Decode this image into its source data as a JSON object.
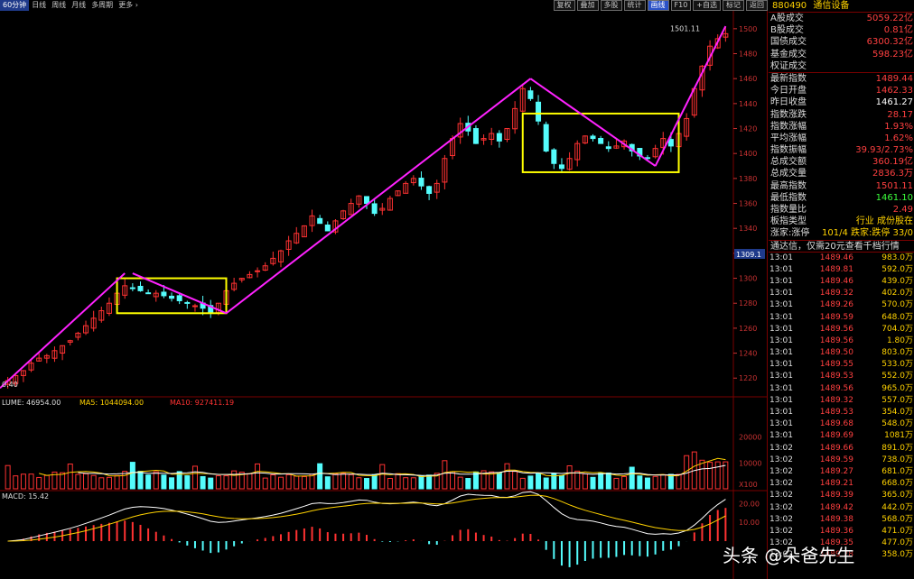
{
  "tabs": [
    {
      "label": "60分钟",
      "active": true
    },
    {
      "label": "日线",
      "active": false
    },
    {
      "label": "周线",
      "active": false
    },
    {
      "label": "月线",
      "active": false
    },
    {
      "label": "多周期",
      "active": false
    },
    {
      "label": "更多 ›",
      "active": false
    }
  ],
  "tools": [
    {
      "label": "复权",
      "active": false
    },
    {
      "label": "叠加",
      "active": false
    },
    {
      "label": "多股",
      "active": false
    },
    {
      "label": "统计",
      "active": false
    },
    {
      "label": "画线",
      "active": true
    },
    {
      "label": "F10",
      "active": false
    },
    {
      "label": "+自选",
      "active": false
    },
    {
      "label": "标记",
      "active": false
    },
    {
      "label": "返回",
      "active": false
    }
  ],
  "chart": {
    "max_label": "1501.11",
    "low_label": "0.40",
    "price_tag": "1309.1",
    "volume_info": {
      "vol": "LUME: 46954.00",
      "ma5": "MA5: 1044094.00",
      "ma10": "MA10: 927411.19"
    },
    "macd_info": "MACD: 15.42",
    "vol_badge": "X100"
  },
  "chart_data": {
    "type": "candlestick",
    "y_ticks": [
      1220,
      1240,
      1260,
      1280,
      1300,
      1320,
      1340,
      1360,
      1380,
      1400,
      1420,
      1440,
      1460,
      1480,
      1500
    ],
    "ylim": [
      1205,
      1510
    ],
    "volume_ticks": [
      10000,
      20000
    ],
    "macd_ticks": [
      10.0,
      20.0
    ],
    "close_series": [
      1218,
      1222,
      1226,
      1232,
      1236,
      1238,
      1242,
      1246,
      1250,
      1256,
      1262,
      1268,
      1274,
      1280,
      1288,
      1294,
      1292,
      1290,
      1288,
      1288,
      1286,
      1284,
      1282,
      1280,
      1278,
      1276,
      1272,
      1280,
      1290,
      1296,
      1300,
      1303,
      1306,
      1310,
      1316,
      1322,
      1330,
      1336,
      1342,
      1350,
      1344,
      1338,
      1346,
      1354,
      1360,
      1366,
      1360,
      1352,
      1356,
      1364,
      1370,
      1376,
      1380,
      1374,
      1368,
      1376,
      1396,
      1412,
      1424,
      1418,
      1408,
      1412,
      1416,
      1410,
      1420,
      1436,
      1452,
      1444,
      1426,
      1402,
      1392,
      1388,
      1396,
      1408,
      1414,
      1412,
      1408,
      1404,
      1406,
      1410,
      1402,
      1398,
      1396,
      1404,
      1412,
      1406,
      1416,
      1428,
      1452,
      1470,
      1486,
      1492,
      1496
    ]
  },
  "side": {
    "code": "880490",
    "name": "通信设备",
    "stats": [
      {
        "label": "A股成交",
        "value": "5059.22亿"
      },
      {
        "label": "B股成交",
        "value": "0.81亿"
      },
      {
        "label": "国债成交",
        "value": "6300.32亿"
      },
      {
        "label": "基金成交",
        "value": "598.23亿"
      },
      {
        "label": "权证成交",
        "value": ""
      }
    ],
    "index": [
      {
        "label": "最新指数",
        "value": "1489.44"
      },
      {
        "label": "今日开盘",
        "value": "1462.33"
      },
      {
        "label": "昨日收盘",
        "value": "1461.27"
      },
      {
        "label": "指数涨跌",
        "value": "28.17"
      },
      {
        "label": "指数涨幅",
        "value": "1.93%"
      },
      {
        "label": "平均涨幅",
        "value": "1.62%"
      },
      {
        "label": "指数振幅",
        "value": "39.93/2.73%"
      },
      {
        "label": "总成交额",
        "value": "360.19亿"
      },
      {
        "label": "总成交量",
        "value": "2836.3万"
      },
      {
        "label": "最高指数",
        "value": "1501.11"
      },
      {
        "label": "最低指数",
        "value": "1461.10"
      },
      {
        "label": "指数量比",
        "value": "2.49"
      },
      {
        "label": "板指类型",
        "value": "行业 成份股在"
      },
      {
        "label": "涨家:涨停",
        "value": "101/4 跌家:跌停 33/0"
      }
    ],
    "promo": "通达信，仅需20元查看千档行情",
    "ticks": [
      {
        "time": "13:01",
        "price": "1489.46",
        "vol": "983.0万"
      },
      {
        "time": "13:01",
        "price": "1489.81",
        "vol": "592.0万"
      },
      {
        "time": "13:01",
        "price": "1489.46",
        "vol": "439.0万"
      },
      {
        "time": "13:01",
        "price": "1489.32",
        "vol": "402.0万"
      },
      {
        "time": "13:01",
        "price": "1489.26",
        "vol": "570.0万"
      },
      {
        "time": "13:01",
        "price": "1489.59",
        "vol": "648.0万"
      },
      {
        "time": "13:01",
        "price": "1489.56",
        "vol": "704.0万"
      },
      {
        "time": "13:01",
        "price": "1489.56",
        "vol": "1.80万"
      },
      {
        "time": "13:01",
        "price": "1489.50",
        "vol": "803.0万"
      },
      {
        "time": "13:01",
        "price": "1489.55",
        "vol": "533.0万"
      },
      {
        "time": "13:01",
        "price": "1489.53",
        "vol": "552.0万"
      },
      {
        "time": "13:01",
        "price": "1489.56",
        "vol": "965.0万"
      },
      {
        "time": "13:01",
        "price": "1489.32",
        "vol": "557.0万"
      },
      {
        "time": "13:01",
        "price": "1489.53",
        "vol": "354.0万"
      },
      {
        "time": "13:01",
        "price": "1489.68",
        "vol": "548.0万"
      },
      {
        "time": "13:01",
        "price": "1489.69",
        "vol": "1081万"
      },
      {
        "time": "13:02",
        "price": "1489.66",
        "vol": "891.0万"
      },
      {
        "time": "13:02",
        "price": "1489.59",
        "vol": "738.0万"
      },
      {
        "time": "13:02",
        "price": "1489.27",
        "vol": "681.0万"
      },
      {
        "time": "13:02",
        "price": "1489.21",
        "vol": "668.0万"
      },
      {
        "time": "13:02",
        "price": "1489.39",
        "vol": "365.0万"
      },
      {
        "time": "13:02",
        "price": "1489.42",
        "vol": "442.0万"
      },
      {
        "time": "13:02",
        "price": "1489.38",
        "vol": "568.0万"
      },
      {
        "time": "13:02",
        "price": "1489.36",
        "vol": "471.0万"
      },
      {
        "time": "13:02",
        "price": "1489.35",
        "vol": "477.0万"
      },
      {
        "time": "13:02",
        "price": "1489.28",
        "vol": "358.0万"
      }
    ]
  },
  "watermark": "头条 @朵爸先生",
  "colors": {
    "up": "#ff3232",
    "down": "#54fcfc",
    "ma_white": "#ffffff",
    "ma_yellow": "#ffd200",
    "annotation": "#ff22ff",
    "box": "#ffff00",
    "grid_red": "#7a0000"
  }
}
